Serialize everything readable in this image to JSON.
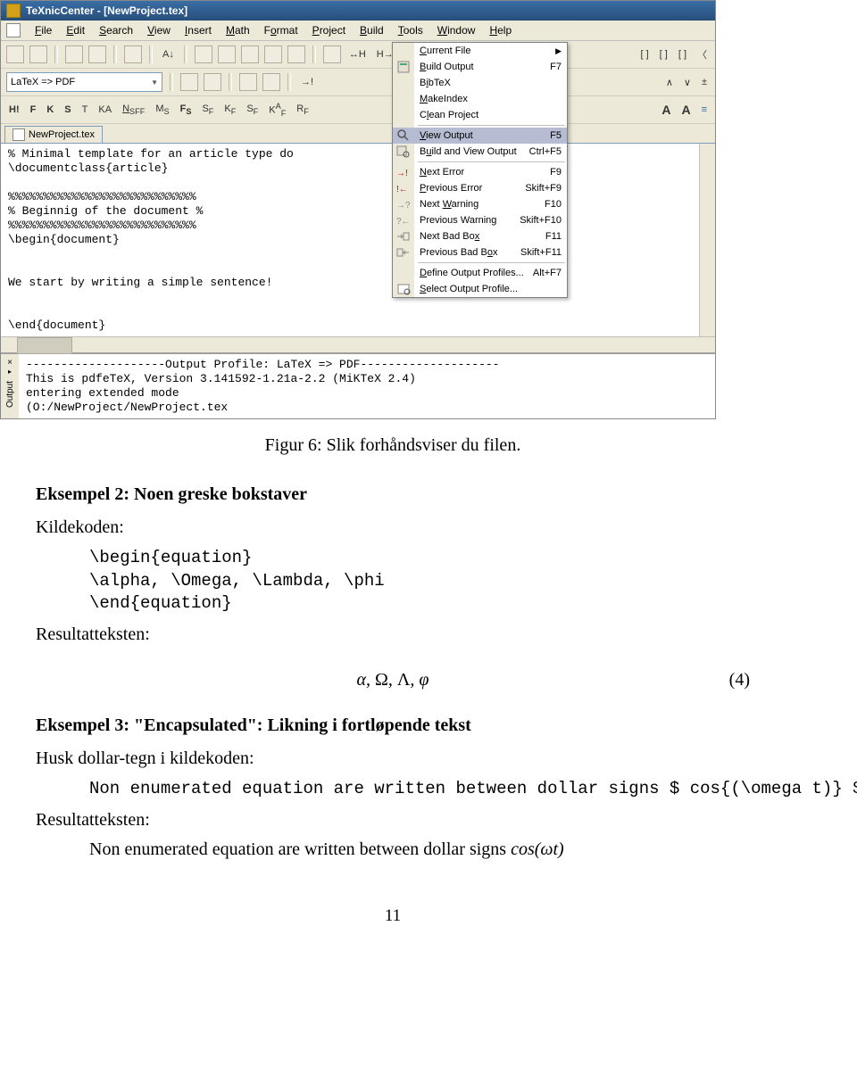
{
  "app": {
    "title": "TeXnicCenter - [NewProject.tex]",
    "menus": [
      "File",
      "Edit",
      "Search",
      "View",
      "Insert",
      "Math",
      "Format",
      "Project",
      "Build",
      "Tools",
      "Window",
      "Help"
    ],
    "profile": "LaTeX => PDF",
    "math_toolbar": [
      "H!",
      "F",
      "K",
      "S",
      "T",
      "KA",
      "N_SFF",
      "M_S",
      "F_S",
      "S_F",
      "K_F",
      "S_F",
      "KA_F",
      "R_F"
    ],
    "open_tab": "NewProject.tex",
    "right_toolbar_glyphs": [
      "A",
      "A",
      "≡",
      "∧",
      "∨",
      "±",
      "[ ]",
      "[  ]",
      "[   ]",
      "〈"
    ]
  },
  "editor_lines": [
    "% Minimal template for an article type do",
    "\\documentclass{article}",
    "",
    "%%%%%%%%%%%%%%%%%%%%%%%%%%%",
    "% Beginnig of the document %",
    "%%%%%%%%%%%%%%%%%%%%%%%%%%%",
    "\\begin{document}",
    "",
    "",
    "We start by writing a simple sentence!",
    "",
    "",
    "\\end{document}"
  ],
  "build_menu": [
    {
      "label": "Current File",
      "sc": "",
      "sub": true
    },
    {
      "label": "Build Output",
      "sc": "F7"
    },
    {
      "label": "BibTeX",
      "sc": ""
    },
    {
      "label": "MakeIndex",
      "sc": ""
    },
    {
      "label": "Clean Project",
      "sc": ""
    },
    {
      "sep": true
    },
    {
      "label": "View Output",
      "sc": "F5",
      "hl": true
    },
    {
      "label": "Build and View Output",
      "sc": "Ctrl+F5"
    },
    {
      "sep": true
    },
    {
      "label": "Next Error",
      "sc": "F9"
    },
    {
      "label": "Previous Error",
      "sc": "Skift+F9"
    },
    {
      "label": "Next Warning",
      "sc": "F10"
    },
    {
      "label": "Previous Warning",
      "sc": "Skift+F10"
    },
    {
      "label": "Next Bad Box",
      "sc": "F11"
    },
    {
      "label": "Previous Bad Box",
      "sc": "Skift+F11"
    },
    {
      "sep": true
    },
    {
      "label": "Define Output Profiles...",
      "sc": "Alt+F7"
    },
    {
      "label": "Select Output Profile...",
      "sc": ""
    }
  ],
  "output": {
    "tab": "Output",
    "lines": [
      "--------------------Output Profile: LaTeX => PDF--------------------",
      "This is pdfeTeX, Version 3.141592-1.21a-2.2 (MiKTeX 2.4)",
      "entering extended mode",
      "(O:/NewProject/NewProject.tex"
    ]
  },
  "doc": {
    "caption": "Figur 6: Slik forhåndsviser du filen.",
    "h2": "Eksempel 2: Noen greske bokstaver",
    "kildekoden": "Kildekoden:",
    "code2": "\\begin{equation}\n\\alpha, \\Omega, \\Lambda, \\phi\n\\end{equation}",
    "resultat": "Resultatteksten:",
    "eq_text": "α, Ω, Λ, φ",
    "eq_num": "(4)",
    "h3": "Eksempel 3: \"Encapsulated\": Likning i fortløpende tekst",
    "husk": "Husk dollar-tegn i kildekoden:",
    "code3": "Non enumerated equation are written between dollar signs $ cos{(\\omega t)} $",
    "result3": "Non enumerated equation are written between dollar signs ",
    "inline_math": "cos(ωt)",
    "pagenum": "11"
  }
}
